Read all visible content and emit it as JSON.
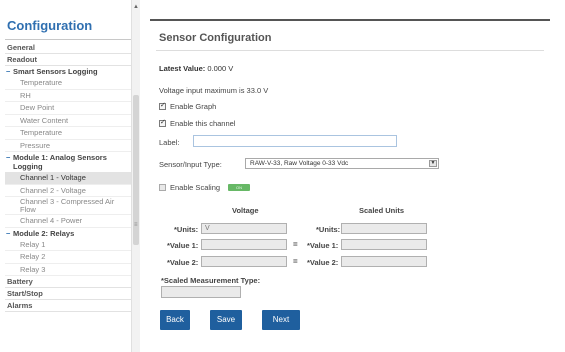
{
  "sidebar": {
    "title": "Configuration",
    "items": [
      {
        "label": "General",
        "kind": "top"
      },
      {
        "label": "Readout",
        "kind": "top"
      },
      {
        "label": "Smart Sensors Logging",
        "kind": "group"
      },
      {
        "label": "Temperature",
        "kind": "sub"
      },
      {
        "label": "RH",
        "kind": "sub"
      },
      {
        "label": "Dew Point",
        "kind": "sub"
      },
      {
        "label": "Water Content",
        "kind": "sub"
      },
      {
        "label": "Temperature",
        "kind": "sub"
      },
      {
        "label": "Pressure",
        "kind": "sub"
      },
      {
        "label": "Module 1: Analog Sensors Logging",
        "kind": "group"
      },
      {
        "label": "Channel 1 - Voltage",
        "kind": "sub",
        "selected": true
      },
      {
        "label": "Channel 2 - Voltage",
        "kind": "sub"
      },
      {
        "label": "Channel 3 - Compressed Air Flow",
        "kind": "sub"
      },
      {
        "label": "Channel 4 - Power",
        "kind": "sub"
      },
      {
        "label": "Module 2: Relays",
        "kind": "group"
      },
      {
        "label": "Relay 1",
        "kind": "sub"
      },
      {
        "label": "Relay 2",
        "kind": "sub"
      },
      {
        "label": "Relay 3",
        "kind": "sub"
      },
      {
        "label": "Battery",
        "kind": "top"
      },
      {
        "label": "Start/Stop",
        "kind": "top"
      },
      {
        "label": "Alarms",
        "kind": "top"
      }
    ]
  },
  "panel": {
    "title": "Sensor Configuration",
    "latest_label": "Latest Value:",
    "latest_value": "0.000 V",
    "vmax_text": "Voltage input maximum is 33.0 V",
    "enable_graph": "Enable Graph",
    "enable_channel": "Enable this channel",
    "label_label": "Label:",
    "label_value": "",
    "sensor_type_label": "Sensor/Input Type:",
    "sensor_type_value": "RAW-V-33, Raw Voltage 0-33 Vdc",
    "enable_scaling": "Enable Scaling",
    "scaling_toggle": "ON",
    "voltage_heading": "Voltage",
    "scaled_heading": "Scaled Units",
    "units_label": "*Units:",
    "units_value": "V",
    "value1_label": "*Value 1:",
    "value2_label": "*Value 2:",
    "equals": "=",
    "scaled_units_label": "*Units:",
    "scaled_value1_label": "*Value 1:",
    "scaled_value2_label": "*Value 2:",
    "scaled_type_label": "*Scaled Measurement Type:",
    "back": "Back",
    "save": "Save",
    "next": "Next"
  },
  "colors": {
    "accent": "#2f6fb0",
    "button": "#1f5f9e",
    "toggle_on": "#67b866"
  }
}
